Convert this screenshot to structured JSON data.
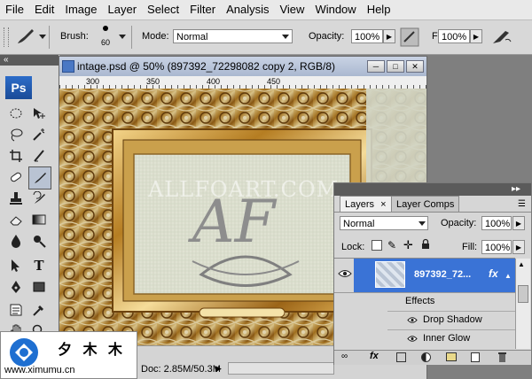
{
  "menu": [
    "File",
    "Edit",
    "Image",
    "Layer",
    "Select",
    "Filter",
    "Analysis",
    "View",
    "Window",
    "Help"
  ],
  "options": {
    "brush_label": "Brush:",
    "brush_size": "60",
    "mode_label": "Mode:",
    "mode_value": "Normal",
    "opacity_label": "Opacity:",
    "opacity_value": "100%",
    "flow_label": "Flow:",
    "flow_value": "100%"
  },
  "tools": {
    "ps_logo": "Ps",
    "collapse": "«",
    "type_tool": "T"
  },
  "document": {
    "title": "intage.psd @ 50% (897392_72298082 copy 2, RGB/8)",
    "ruler_ticks": [
      "300",
      "350",
      "400",
      "450"
    ],
    "watermark_text": "ALLFOART.COM",
    "monogram": "AF",
    "status": "Doc: 2.85M/50.3M"
  },
  "layers_panel": {
    "tabs": [
      "Layers",
      "Layer Comps"
    ],
    "tab_close": "×",
    "blend_mode": "Normal",
    "opacity_label": "Opacity:",
    "opacity_value": "100%",
    "lock_label": "Lock:",
    "fill_label": "Fill:",
    "fill_value": "100%",
    "layer_name": "897392_72...",
    "fx": "fx",
    "effects_label": "Effects",
    "effects": [
      "Drop Shadow",
      "Inner Glow"
    ]
  },
  "brand": {
    "chinese": "夕 木 木",
    "url": "www.ximumu.cn"
  },
  "colors": {
    "selection_blue": "#3a73d6",
    "gold": "#c28b2a",
    "canvas_bg": "#dfe2d2"
  }
}
